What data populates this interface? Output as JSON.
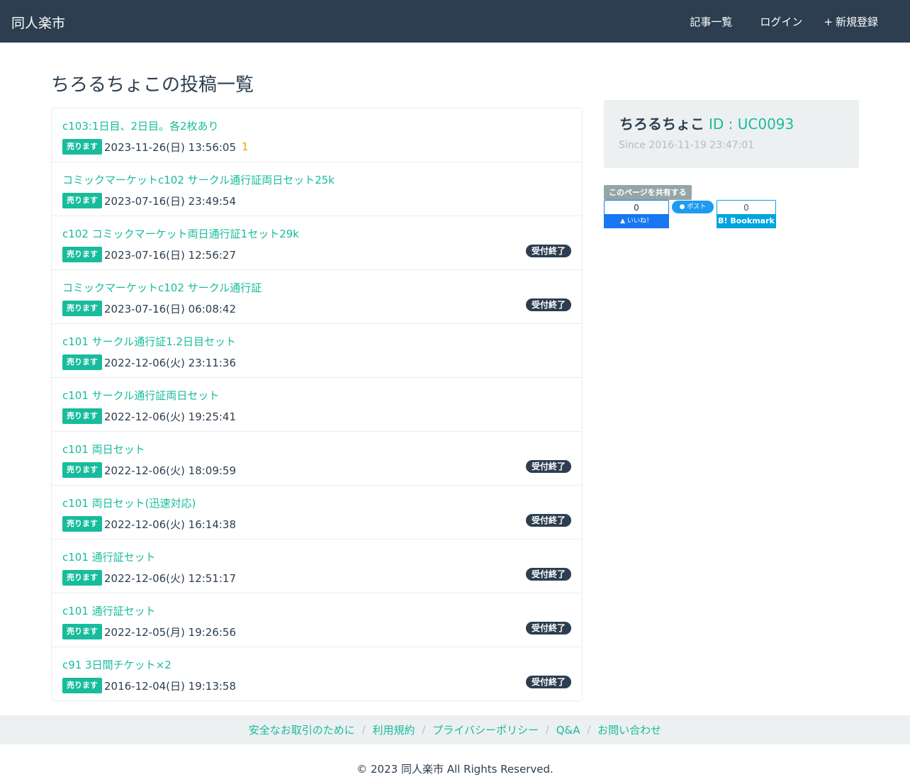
{
  "navbar": {
    "brand": "同人楽市",
    "links": [
      {
        "icon": "",
        "label": "記事一覧"
      },
      {
        "icon": "",
        "label": "ログイン"
      },
      {
        "icon": "+",
        "label": "新規登録"
      }
    ]
  },
  "page_title": "ちろるちょこの投稿一覧",
  "posts": [
    {
      "title": "c103:1日目、2日目。各2枚あり",
      "badge": "売ります",
      "date": "2023-11-26(日) 13:56:05",
      "comment_icon": "",
      "comments": "1",
      "status": ""
    },
    {
      "title": "コミックマーケットc102 サークル通行証両日セット25k",
      "badge": "売ります",
      "date": "2023-07-16(日) 23:49:54",
      "comments": "",
      "status": ""
    },
    {
      "title": "c102 コミックマーケット両日通行証1セット29k",
      "badge": "売ります",
      "date": "2023-07-16(日) 12:56:27",
      "comments": "",
      "status": "受付終了"
    },
    {
      "title": "コミックマーケットc102 サークル通行証",
      "badge": "売ります",
      "date": "2023-07-16(日) 06:08:42",
      "comments": "",
      "status": "受付終了"
    },
    {
      "title": "c101 サークル通行証1.2日目セット",
      "badge": "売ります",
      "date": "2022-12-06(火) 23:11:36",
      "comments": "",
      "status": ""
    },
    {
      "title": "c101 サークル通行証両日セット",
      "badge": "売ります",
      "date": "2022-12-06(火) 19:25:41",
      "comments": "",
      "status": ""
    },
    {
      "title": "c101 両日セット",
      "badge": "売ります",
      "date": "2022-12-06(火) 18:09:59",
      "comments": "",
      "status": "受付終了"
    },
    {
      "title": "c101 両日セット(迅速対応)",
      "badge": "売ります",
      "date": "2022-12-06(火) 16:14:38",
      "comments": "",
      "status": "受付終了"
    },
    {
      "title": "c101 通行証セット",
      "badge": "売ります",
      "date": "2022-12-06(火) 12:51:17",
      "comments": "",
      "status": "受付終了"
    },
    {
      "title": "c101 通行証セット",
      "badge": "売ります",
      "date": "2022-12-05(月) 19:26:56",
      "comments": "",
      "status": "受付終了"
    },
    {
      "title": "c91 3日間チケット×2",
      "badge": "売ります",
      "date": "2016-12-04(日) 19:13:58",
      "comments": "",
      "status": "受付終了"
    }
  ],
  "profile": {
    "user_icon": "",
    "name": "ちろるちょこ",
    "id_text": "ID : UC0093",
    "clock_icon": "",
    "since": "Since 2016-11-19 23:47:01"
  },
  "share": {
    "label": "このページを共有する",
    "facebook_count": "0",
    "facebook_button": "いいね！",
    "twitter_button": "ポスト",
    "hatena_count": "0",
    "hatena_button": "B! Bookmark"
  },
  "footer": {
    "links": [
      "安全なお取引のために",
      "利用規約",
      "プライバシーポリシー",
      "Q&A",
      "お問い合わせ"
    ],
    "separator": "/",
    "copyright": "© 2023 同人楽市 All Rights Reserved."
  },
  "colors": {
    "navbar_bg": "#2c3e50",
    "accent": "#18bc9c",
    "closed_badge": "#2c3e50",
    "comment": "#f39c12",
    "panel_bg": "#ecf0f1"
  }
}
